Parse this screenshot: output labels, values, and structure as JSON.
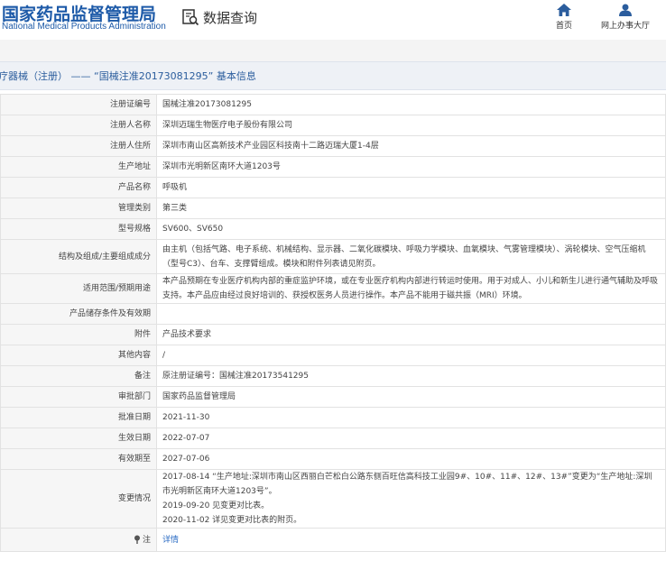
{
  "header": {
    "logo_cn": "国家药品监督管理局",
    "logo_en": "National Medical Products Administration",
    "query_label": "数据查询",
    "nav": [
      {
        "label": "首页",
        "icon": "home-icon"
      },
      {
        "label": "网上办事大厅",
        "icon": "user-icon"
      }
    ]
  },
  "title_bar": {
    "text": "疗器械（注册） —— “国械注准20173081295” 基本信息"
  },
  "rows": [
    {
      "key": "注册证编号",
      "value": "国械注准20173081295"
    },
    {
      "key": "注册人名称",
      "value": "深圳迈瑞生物医疗电子股份有限公司"
    },
    {
      "key": "注册人住所",
      "value": "深圳市南山区高新技术产业园区科技南十二路迈瑞大厦1-4层"
    },
    {
      "key": "生产地址",
      "value": "深圳市光明新区南环大道1203号"
    },
    {
      "key": "产品名称",
      "value": "呼吸机"
    },
    {
      "key": "管理类别",
      "value": "第三类"
    },
    {
      "key": "型号规格",
      "value": "SV600、SV650"
    },
    {
      "key": "结构及组成/主要组成成分",
      "value": "由主机（包括气路、电子系统、机械结构、显示器、二氧化碳模块、呼吸力学模块、血氧模块、气雾管理模块）、涡轮模块、空气压缩机（型号C3）、台车、支撑臂组成。模块和附件列表请见附页。"
    },
    {
      "key": "适用范围/预期用途",
      "value": "本产品预期在专业医疗机构内部的重症监护环境，或在专业医疗机构内部进行转运时使用。用于对成人、小儿和新生儿进行通气辅助及呼吸支持。本产品应由经过良好培训的、获授权医务人员进行操作。本产品不能用于磁共振（MRI）环境。"
    },
    {
      "key": "产品储存条件及有效期",
      "value": ""
    },
    {
      "key": "附件",
      "value": "产品技术要求"
    },
    {
      "key": "其他内容",
      "value": "/"
    },
    {
      "key": "备注",
      "value": "原注册证编号：国械注准20173541295"
    },
    {
      "key": "审批部门",
      "value": "国家药品监督管理局"
    },
    {
      "key": "批准日期",
      "value": "2021-11-30"
    },
    {
      "key": "生效日期",
      "value": "2022-07-07"
    },
    {
      "key": "有效期至",
      "value": "2027-07-06"
    },
    {
      "key": "变更情况",
      "value": "2017-08-14 “生产地址:深圳市南山区西丽白芒松白公路东侧百旺信高科技工业园9#、10#、11#、12#、13#”变更为“生产地址:深圳市光明新区南环大道1203号”。\n2019-09-20 见变更对比表。\n2020-11-02 详见变更对比表的附页。"
    },
    {
      "key": "注",
      "value": "详情",
      "is_link": true,
      "key_icon": "pin-icon"
    }
  ]
}
